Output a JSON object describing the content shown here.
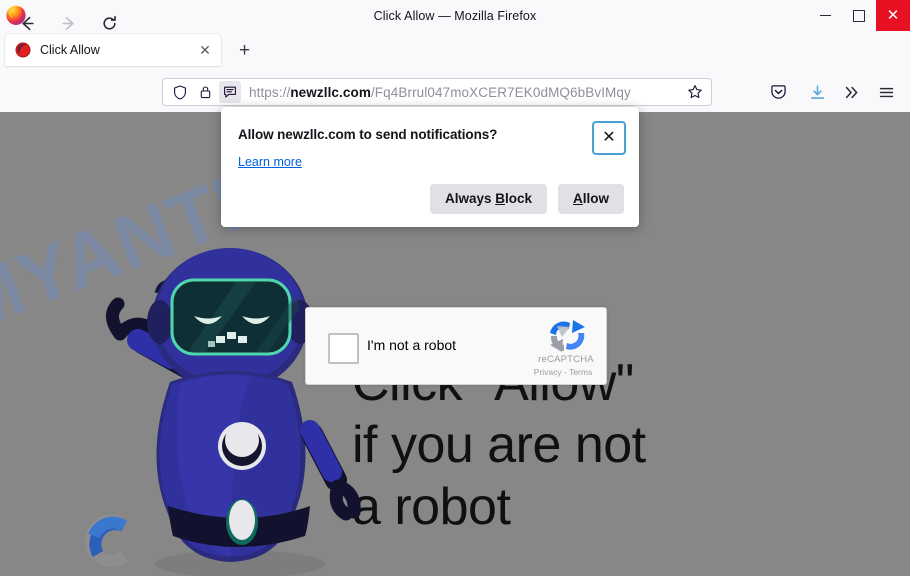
{
  "window": {
    "title": "Click Allow — Mozilla Firefox",
    "controls": {
      "minimize": "minimize-button",
      "maximize": "maximize-button",
      "close": "✕"
    }
  },
  "tabbar": {
    "tabs": [
      {
        "label": "Click Allow",
        "close": "✕",
        "favicon": "site-favicon"
      }
    ],
    "new_tab": "+"
  },
  "toolbar": {
    "back": "back-arrow-icon",
    "forward": "forward-arrow-icon",
    "reload": "reload-icon",
    "pocket": "pocket-icon",
    "downloads": "download-icon",
    "overflow": "»",
    "menu": "hamburger-menu-icon"
  },
  "urlbar": {
    "shield_icon": "tracking-protection-shield",
    "lock_icon": "connection-lock",
    "notification_icon": "notification-permission-bubble",
    "url_domain": "newzllc.com",
    "url_scheme": "https://",
    "url_path": "/Fq4Brrul047moXCER7EK0dMQ6bBvIMqy",
    "bookmark_icon": "star-bookmark"
  },
  "notification_dialog": {
    "title": "Allow newzllc.com to send notifications?",
    "learn_more": "Learn more",
    "close": "✕",
    "buttons": [
      {
        "label_prefix": "Always ",
        "accesskey": "B",
        "label_suffix": "lock",
        "name": "always-block-button"
      },
      {
        "label_prefix": "",
        "accesskey": "A",
        "label_suffix": "llow",
        "name": "allow-button"
      }
    ]
  },
  "recaptcha": {
    "checkbox_label": "I'm not a robot",
    "brand": "reCAPTCHA",
    "terms": "Privacy - Terms"
  },
  "page": {
    "question_marks": "??",
    "heading_line1": "Click \"Allow\"",
    "heading_line2": "if you are not",
    "heading_line3": "a robot",
    "watermark": "MYANTISPYWARE.COM",
    "background_color": "#878787",
    "robot_color": "#2f2fa8",
    "accent_blue": "#0060df"
  }
}
